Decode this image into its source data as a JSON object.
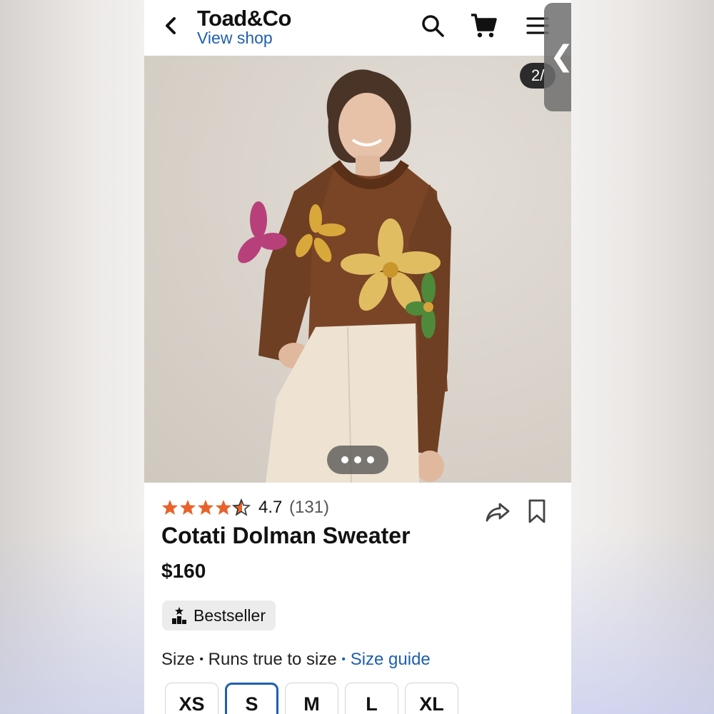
{
  "header": {
    "shop_name": "Toad&Co",
    "view_shop_label": "View shop"
  },
  "gallery": {
    "counter": "2/"
  },
  "product": {
    "rating": "4.7",
    "reviews": "(131)",
    "star_rating": 4.7,
    "title": "Cotati Dolman Sweater",
    "price": "$160",
    "badge": "Bestseller"
  },
  "size": {
    "label": "Size",
    "separator": "•",
    "fit": "Runs true to size",
    "guide_link": "Size guide",
    "options": [
      "XS",
      "S",
      "M",
      "L",
      "XL"
    ],
    "selected": "S"
  },
  "colors": {
    "accent_link": "#1f5fb0",
    "star": "#e8632b",
    "selected_border": "#1f5fb0"
  }
}
